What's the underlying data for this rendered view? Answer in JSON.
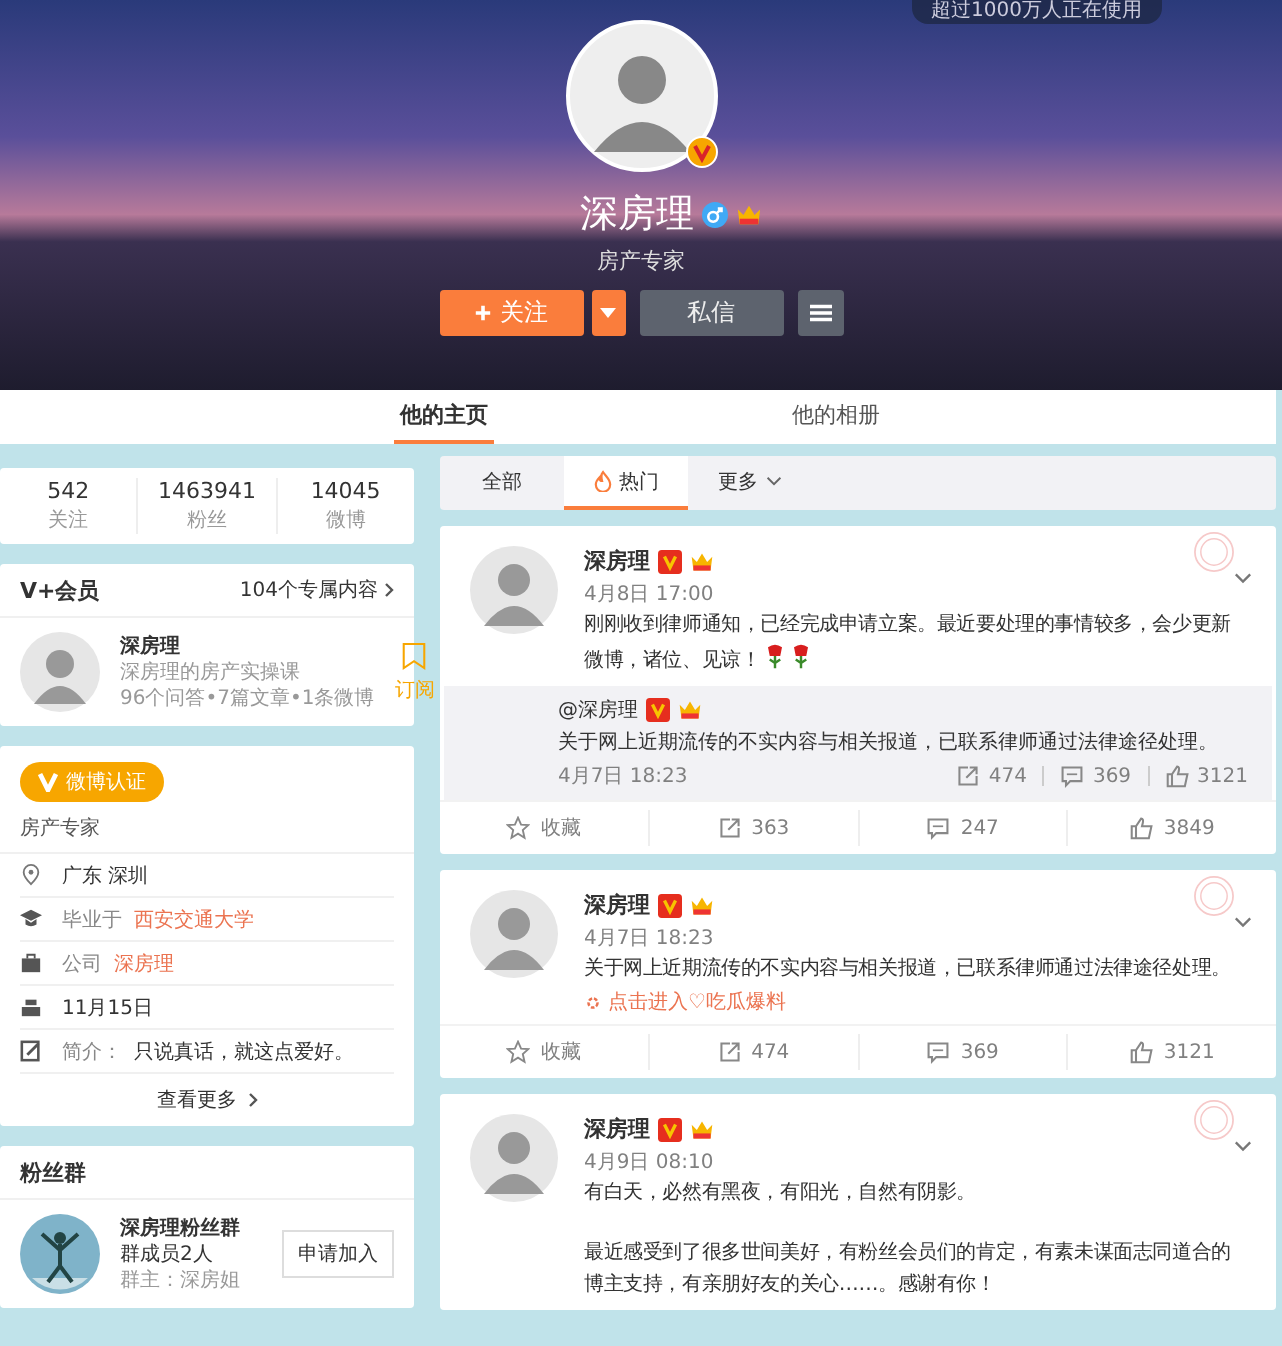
{
  "banner": {
    "promo": "超过1000万人正在使用",
    "name": "深房理",
    "title": "房产专家",
    "follow": "关注",
    "message": "私信"
  },
  "profile_tabs": [
    {
      "label": "他的主页",
      "selected": true
    },
    {
      "label": "他的相册",
      "selected": false
    }
  ],
  "stats": [
    {
      "value": "542",
      "label": "关注"
    },
    {
      "value": "1463941",
      "label": "粉丝"
    },
    {
      "value": "14045",
      "label": "微博"
    }
  ],
  "vplus": {
    "title": "V+会员",
    "link": "104个专属内容",
    "name": "深房理",
    "course": "深房理的房产实操课",
    "counts": "96个问答•7篇文章•1条微博",
    "action": "订阅"
  },
  "about": {
    "badge": "微博认证",
    "verified_as": "房产专家",
    "more": "查看更多",
    "rows": [
      {
        "kind": "location",
        "text": "广东 深圳"
      },
      {
        "kind": "school",
        "label": "毕业于",
        "link": "西安交通大学"
      },
      {
        "kind": "company",
        "label": "公司",
        "link": "深房理"
      },
      {
        "kind": "birthday",
        "text": "11月15日"
      },
      {
        "kind": "bio",
        "label": "简介：",
        "text": "只说真话，就这点爱好。"
      }
    ]
  },
  "fan_group": {
    "title": "粉丝群",
    "name": "深房理粉丝群",
    "members": "群成员2人",
    "owner": "群主：深房姐",
    "button": "申请加入"
  },
  "feed_tabs": [
    {
      "kind": "plain",
      "label": "全部",
      "selected": false
    },
    {
      "kind": "hot",
      "label": "热门",
      "selected": true
    },
    {
      "kind": "dropdown",
      "label": "更多",
      "selected": false
    }
  ],
  "posts": [
    {
      "author": "深房理",
      "time": "4月8日 17:00",
      "paragraphs": [
        "刚刚收到律师通知，已经完成申请立案。最近要处理的事情较多，会少更新微博，诸位、见谅！"
      ],
      "emoji": [
        {
          "kind": "rose"
        },
        {
          "kind": "rose"
        }
      ],
      "repost": {
        "author": "@深房理",
        "text": "关于网上近期流传的不实内容与相关报道，已联系律师通过法律途径处理。",
        "time": "4月7日 18:23",
        "reposts": "474",
        "comments": "369",
        "likes": "3121"
      },
      "actions": {
        "favorite": "收藏",
        "reposts": "363",
        "comments": "247",
        "likes": "3849"
      }
    },
    {
      "author": "深房理",
      "time": "4月7日 18:23",
      "paragraphs": [
        "关于网上近期流传的不实内容与相关报道，已联系律师通过法律途径处理。"
      ],
      "topic_link": "点击进入♡吃瓜爆料",
      "actions": {
        "favorite": "收藏",
        "reposts": "474",
        "comments": "369",
        "likes": "3121"
      }
    },
    {
      "author": "深房理",
      "time": "4月9日 08:10",
      "paragraphs": [
        "有白天，必然有黑夜，有阳光，自然有阴影。",
        "最近感受到了很多世间美好，有粉丝会员们的肯定，有素未谋面志同道合的博主支持，有亲朋好友的关心……。感谢有你！"
      ]
    }
  ]
}
